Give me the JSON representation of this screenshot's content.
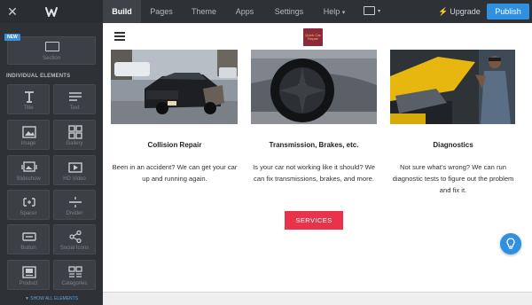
{
  "sidebar": {
    "new_badge": "NEW",
    "section_tile_label": "Section",
    "heading": "INDIVIDUAL ELEMENTS",
    "tiles": [
      {
        "label": "Title",
        "icon": "title-icon"
      },
      {
        "label": "Text",
        "icon": "text-icon"
      },
      {
        "label": "Image",
        "icon": "image-icon"
      },
      {
        "label": "Gallery",
        "icon": "gallery-icon"
      },
      {
        "label": "Slideshow",
        "icon": "slideshow-icon"
      },
      {
        "label": "HD Video",
        "icon": "video-icon"
      },
      {
        "label": "Spacer",
        "icon": "spacer-icon"
      },
      {
        "label": "Divider",
        "icon": "divider-icon"
      },
      {
        "label": "Button",
        "icon": "button-icon"
      },
      {
        "label": "Social Icons",
        "icon": "share-icon"
      },
      {
        "label": "Product",
        "icon": "product-icon"
      },
      {
        "label": "Categories",
        "icon": "categories-icon"
      }
    ],
    "show_all": "▼ SHOW ALL ELEMENTS"
  },
  "topbar": {
    "tabs": [
      "Build",
      "Pages",
      "Theme",
      "Apps",
      "Settings",
      "Help"
    ],
    "help_caret": "▾",
    "active_tab": "Build",
    "upgrade_label": "Upgrade",
    "publish_label": "Publish"
  },
  "site": {
    "logo_text": "Quick Car Repair",
    "services": [
      {
        "title": "Collision Repair",
        "description": "Been in an accident? We can get your car up and running again."
      },
      {
        "title": "Transmission, Brakes, etc.",
        "description": "Is your car not working like it should? We can fix transmissions, brakes, and more."
      },
      {
        "title": "Diagnostics",
        "description": "Not sure what's wrong? We can run diagnostic tests to figure out the problem and fix it."
      }
    ],
    "button_label": "SERVICES"
  },
  "colors": {
    "accent": "#2f8fe0",
    "button": "#e8334a",
    "sidebar_bg": "#2e3136"
  }
}
